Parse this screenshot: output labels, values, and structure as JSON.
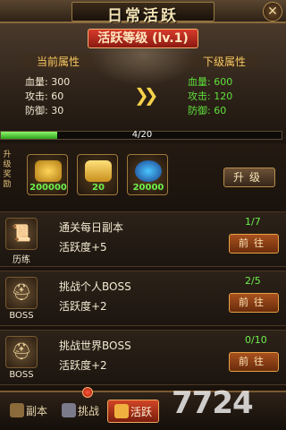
{
  "header": {
    "title": "日常活跃",
    "level_badge": "活跃等级 (lv.1)"
  },
  "current_attrs": {
    "heading": "当前属性",
    "hp": "血量: 300",
    "attack": "攻击: 60",
    "defense": "防御: 30"
  },
  "next_attrs": {
    "heading": "下级属性",
    "hp": "血量: 600",
    "attack": "攻击: 120",
    "defense": "防御: 60"
  },
  "exp": {
    "text": "4/20",
    "fraction": 0.2
  },
  "rewards": {
    "side_label": "升级奖励",
    "items": [
      {
        "icon": "gold-coins-icon",
        "count": "200000"
      },
      {
        "icon": "gold-ingot-icon",
        "count": "20"
      },
      {
        "icon": "exp-orb-icon",
        "count": "20000"
      }
    ],
    "upgrade_label": "升级"
  },
  "tasks": [
    {
      "icon": "scroll-icon",
      "icon_label": "历练",
      "name": "通关每日副本",
      "reward": "活跃度+5",
      "progress": "1/7",
      "button": "前往"
    },
    {
      "icon": "boss-helmet-icon",
      "icon_label": "BOSS",
      "name": "挑战个人BOSS",
      "reward": "活跃度+2",
      "progress": "2/5",
      "button": "前往"
    },
    {
      "icon": "boss-helmet-icon",
      "icon_label": "BOSS",
      "name": "挑战世界BOSS",
      "reward": "活跃度+2",
      "progress": "0/10",
      "button": "前往"
    }
  ],
  "tabs": [
    {
      "label": "副本",
      "icon": "dungeon-icon"
    },
    {
      "label": "挑战",
      "icon": "swords-icon"
    },
    {
      "label": "活跃",
      "icon": "flame-icon"
    }
  ],
  "watermark": "7724"
}
